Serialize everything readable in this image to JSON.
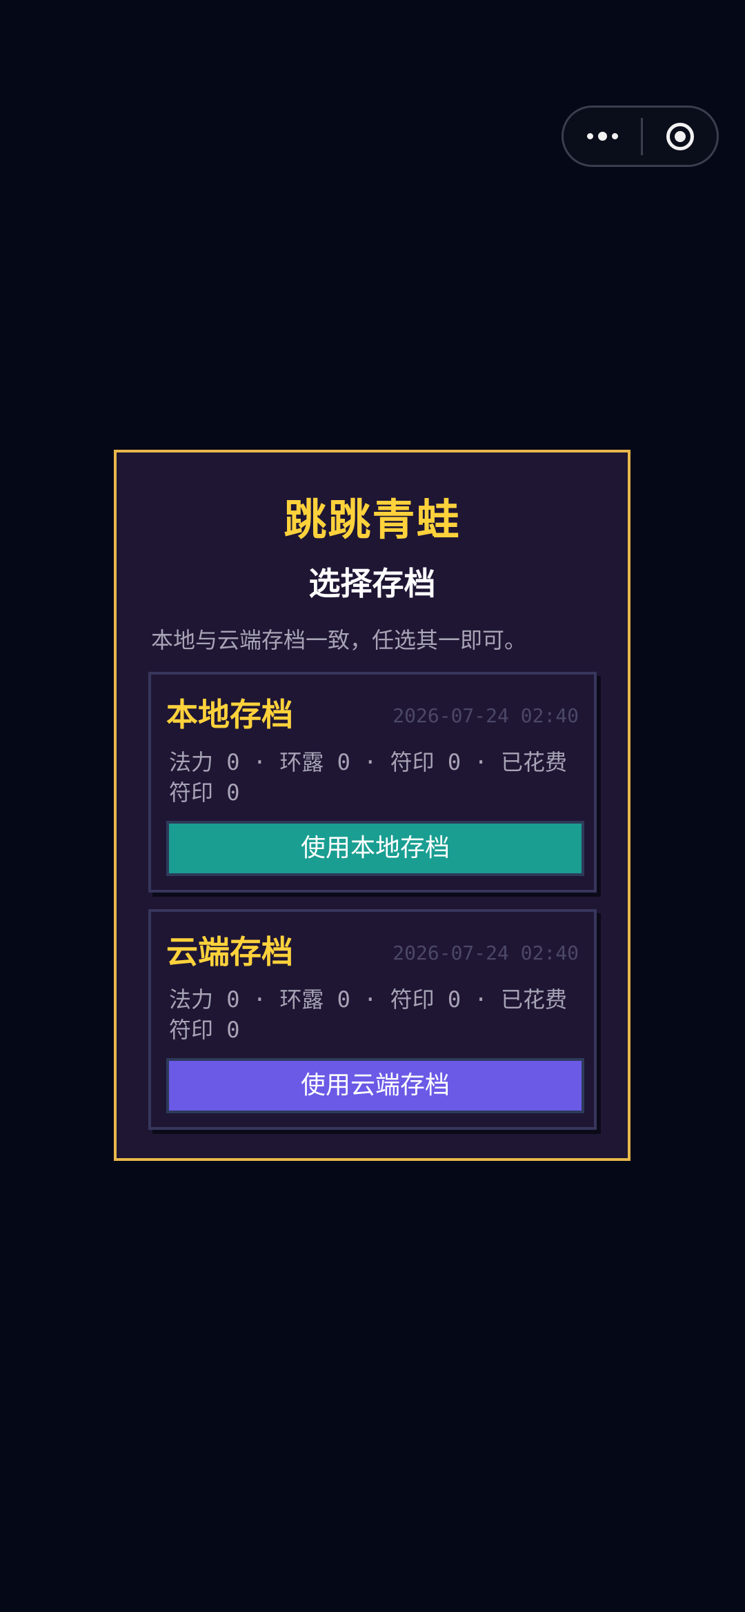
{
  "capsule": {
    "more_icon": "more-dots-icon",
    "close_icon": "target-close-icon"
  },
  "dialog": {
    "game_title": "跳跳青蛙",
    "subtitle": "选择存档",
    "hint": "本地与云端存档一致，任选其一即可。",
    "saves": [
      {
        "title": "本地存档",
        "time": "2026-07-24 02:40",
        "stats": "法力 0 · 环露 0 · 符印 0 · 已花费符印 0",
        "button_label": "使用本地存档",
        "button_color": "#1a9e92"
      },
      {
        "title": "云端存档",
        "time": "2026-07-24 02:40",
        "stats": "法力 0 · 环露 0 · 符印 0 · 已花费符印 0",
        "button_label": "使用云端存档",
        "button_color": "#6a5ae6"
      }
    ]
  },
  "colors": {
    "background": "#050816",
    "dialog_border": "#e8b84a",
    "dialog_bg": "#1f1634",
    "title": "#ffd23c"
  }
}
